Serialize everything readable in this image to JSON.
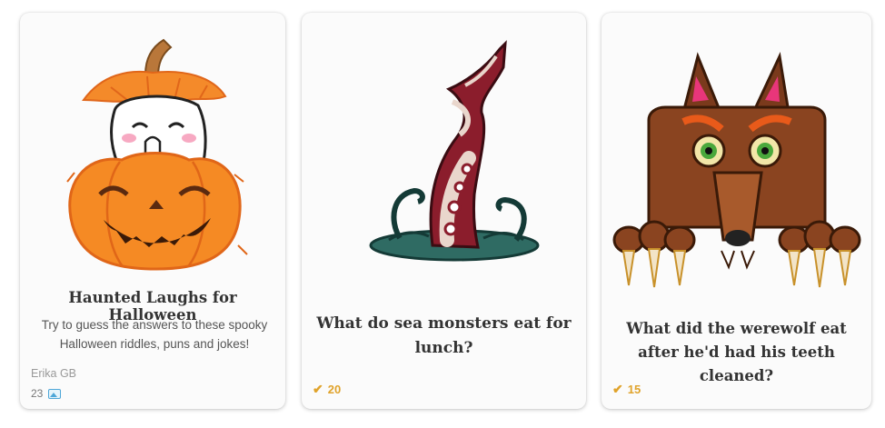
{
  "cards": [
    {
      "title": "Haunted Laughs for Halloween",
      "description": "Try to guess the answers to these spooky Halloween riddles, puns and jokes!",
      "author": "Erika GB",
      "count": "23",
      "illustration": "pumpkin-ghost-icon"
    },
    {
      "title": "What do sea monsters eat for lunch?",
      "score": "20",
      "illustration": "tentacle-icon"
    },
    {
      "title": "What did the werewolf eat after he'd had his teeth cleaned?",
      "score": "15",
      "illustration": "werewolf-icon"
    }
  ],
  "colors": {
    "accent_check": "#e0a32b",
    "pumpkin": "#f07d22",
    "tentacle": "#8b1d2c",
    "werewolf": "#7a3a1c"
  }
}
